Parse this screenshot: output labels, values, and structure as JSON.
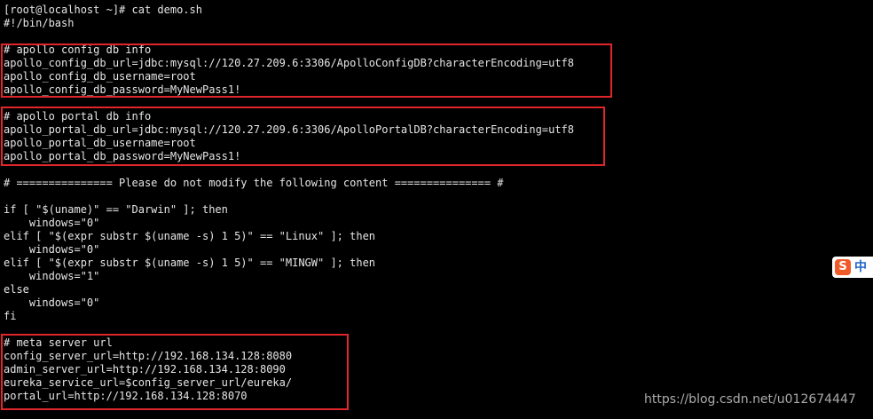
{
  "terminal": {
    "lines": [
      "[root@localhost ~]# cat demo.sh",
      "#!/bin/bash",
      "",
      "# apollo config db info",
      "apollo_config_db_url=jdbc:mysql://120.27.209.6:3306/ApolloConfigDB?characterEncoding=utf8",
      "apollo_config_db_username=root",
      "apollo_config_db_password=MyNewPass1!",
      "",
      "# apollo portal db info",
      "apollo_portal_db_url=jdbc:mysql://120.27.209.6:3306/ApolloPortalDB?characterEncoding=utf8",
      "apollo_portal_db_username=root",
      "apollo_portal_db_password=MyNewPass1!",
      "",
      "# =============== Please do not modify the following content =============== #",
      "",
      "if [ \"$(uname)\" == \"Darwin\" ]; then",
      "    windows=\"0\"",
      "elif [ \"$(expr substr $(uname -s) 1 5)\" == \"Linux\" ]; then",
      "    windows=\"0\"",
      "elif [ \"$(expr substr $(uname -s) 1 5)\" == \"MINGW\" ]; then",
      "    windows=\"1\"",
      "else",
      "    windows=\"0\"",
      "fi",
      "",
      "# meta server url",
      "config_server_url=http://192.168.134.128:8080",
      "admin_server_url=http://192.168.134.128:8090",
      "eureka_service_url=$config_server_url/eureka/",
      "portal_url=http://192.168.134.128:8070"
    ]
  },
  "highlight_color": "#e0262b",
  "ime": {
    "logo": "S",
    "lang": "中"
  },
  "watermark": "https://blog.csdn.net/u012674447"
}
